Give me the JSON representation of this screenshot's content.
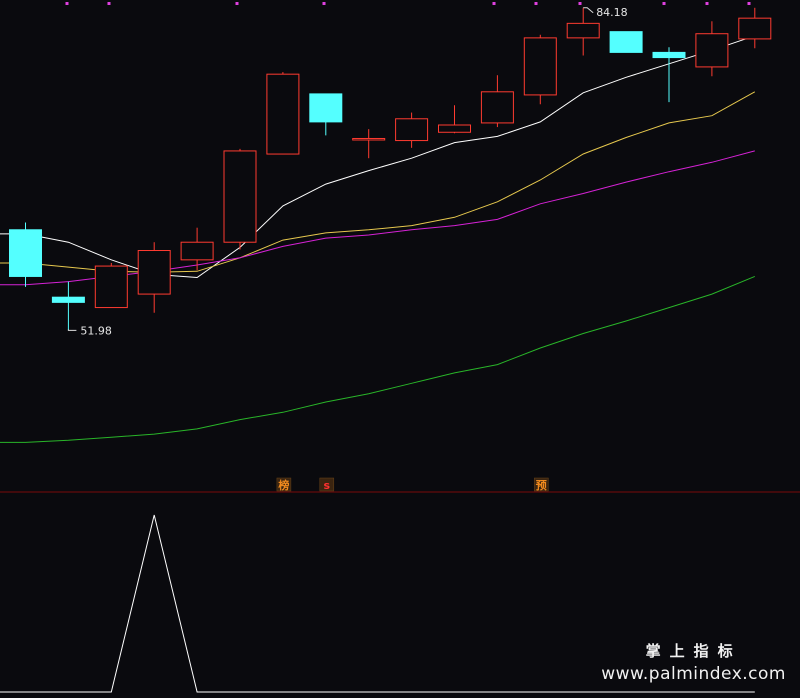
{
  "chart_data": {
    "type": "candlestick",
    "candles": [
      {
        "open": 62.8,
        "high": 63.5,
        "low": 57.3,
        "close": 58.3
      },
      {
        "open": 56.3,
        "high": 57.8,
        "low": 53.1,
        "close": 55.8
      },
      {
        "open": 55.3,
        "high": 59.6,
        "low": 55.3,
        "close": 59.3
      },
      {
        "open": 56.6,
        "high": 61.6,
        "low": 54.8,
        "close": 60.8
      },
      {
        "open": 59.9,
        "high": 63.0,
        "low": 58.9,
        "close": 61.6
      },
      {
        "open": 61.6,
        "high": 70.6,
        "low": 60.9,
        "close": 70.4
      },
      {
        "open": 70.1,
        "high": 78.0,
        "low": 70.1,
        "close": 77.8
      },
      {
        "open": 75.9,
        "high": 75.9,
        "low": 71.9,
        "close": 73.2
      },
      {
        "open": 71.6,
        "high": 72.5,
        "low": 69.7,
        "close": 71.6
      },
      {
        "open": 71.4,
        "high": 74.1,
        "low": 70.7,
        "close": 73.5
      },
      {
        "open": 72.2,
        "high": 74.8,
        "low": 72.1,
        "close": 72.9
      },
      {
        "open": 73.1,
        "high": 77.7,
        "low": 72.7,
        "close": 76.1
      },
      {
        "open": 75.8,
        "high": 81.6,
        "low": 74.9,
        "close": 81.3
      },
      {
        "open": 81.3,
        "high": 84.2,
        "low": 79.6,
        "close": 82.7
      },
      {
        "open": 81.9,
        "high": 81.9,
        "low": 79.9,
        "close": 79.9
      },
      {
        "open": 79.9,
        "high": 80.4,
        "low": 75.1,
        "close": 79.4
      },
      {
        "open": 78.5,
        "high": 82.9,
        "low": 77.6,
        "close": 81.7
      },
      {
        "open": 81.2,
        "high": 84.2,
        "low": 80.3,
        "close": 83.2
      }
    ],
    "ma_lines": [
      {
        "color": "#ffffff",
        "values": [
          62.4,
          61.6,
          59.9,
          58.5,
          58.2,
          61.1,
          65.1,
          67.2,
          68.5,
          69.7,
          71.2,
          71.8,
          73.2,
          76.0,
          77.5,
          78.8,
          80.1,
          81.5
        ]
      },
      {
        "color": "#e6c84e",
        "values": [
          59.6,
          59.2,
          58.8,
          58.7,
          58.8,
          60.1,
          61.8,
          62.5,
          62.8,
          63.2,
          64.0,
          65.5,
          67.6,
          70.1,
          71.7,
          73.1,
          73.8,
          76.1
        ]
      },
      {
        "color": "#d522d5",
        "values": [
          57.5,
          57.8,
          58.3,
          58.8,
          59.4,
          60.1,
          61.2,
          62.0,
          62.3,
          62.8,
          63.2,
          63.8,
          65.3,
          66.3,
          67.4,
          68.4,
          69.3,
          70.4
        ]
      },
      {
        "color": "#29b529",
        "values": [
          42.3,
          42.5,
          42.8,
          43.1,
          43.6,
          44.5,
          45.2,
          46.2,
          47.0,
          48.0,
          49.0,
          49.8,
          51.4,
          52.8,
          54.0,
          55.3,
          56.6,
          58.3
        ]
      }
    ],
    "max_label": "84.18",
    "min_label": "51.98",
    "signals": [
      {
        "index": 6,
        "label": "榜",
        "color": "#f08a1e"
      },
      {
        "index": 7,
        "label": "s",
        "color": "#ff3030"
      },
      {
        "index": 12,
        "label": "预",
        "color": "#f08a1e"
      }
    ],
    "indicator": {
      "values": [
        0,
        0,
        0,
        1,
        0,
        0,
        0,
        0,
        0,
        0,
        0,
        0,
        0,
        0,
        0,
        0,
        0,
        0
      ],
      "color": "#ffffff"
    },
    "colors": {
      "up": "#ff3b30",
      "down": "#54ffff",
      "background": "#0a0a0e",
      "separator": "#7a0a0a",
      "top_marks": "#e040e0"
    }
  },
  "watermark": {
    "title": "掌上指标",
    "url": "www.palmindex.com"
  }
}
